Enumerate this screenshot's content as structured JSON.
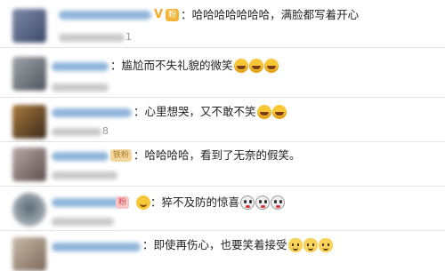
{
  "colors": {
    "comment_text": "#222222",
    "divider": "#e4e4e4",
    "vip_badge": "#f6a623",
    "fan_badge": "#f3b63a"
  },
  "comments": [
    {
      "text": "：哈哈哈哈哈哈哈，满脸都写着开心",
      "badges": [
        "V",
        "粉"
      ],
      "timestamp_visible": "1",
      "emojis": []
    },
    {
      "text": "：尴尬而不失礼貌的微笑",
      "badges": [],
      "emojis": [
        "laughing-tears-icon",
        "laughing-tears-icon",
        "laughing-tears-icon"
      ]
    },
    {
      "text": "：心里想哭，又不敢不笑",
      "badges": [],
      "timestamp_visible": "8",
      "emojis": [
        "laughing-tears-icon",
        "laughing-tears-icon"
      ]
    },
    {
      "text": "：哈哈哈哈，看到了无奈的假笑。",
      "badges": [
        "铁粉"
      ],
      "emojis": []
    },
    {
      "text": "：猝不及防的惊喜",
      "badges": [
        "粉"
      ],
      "emojis": [
        "smile-icon",
        "husky-face-icon",
        "husky-face-icon",
        "husky-face-icon"
      ]
    },
    {
      "text": "：即使再伤心，也要笑着接受",
      "badges": [],
      "emojis": [
        "smiling-cat-icon",
        "smiling-cat-icon",
        "smiling-cat-icon"
      ]
    }
  ]
}
